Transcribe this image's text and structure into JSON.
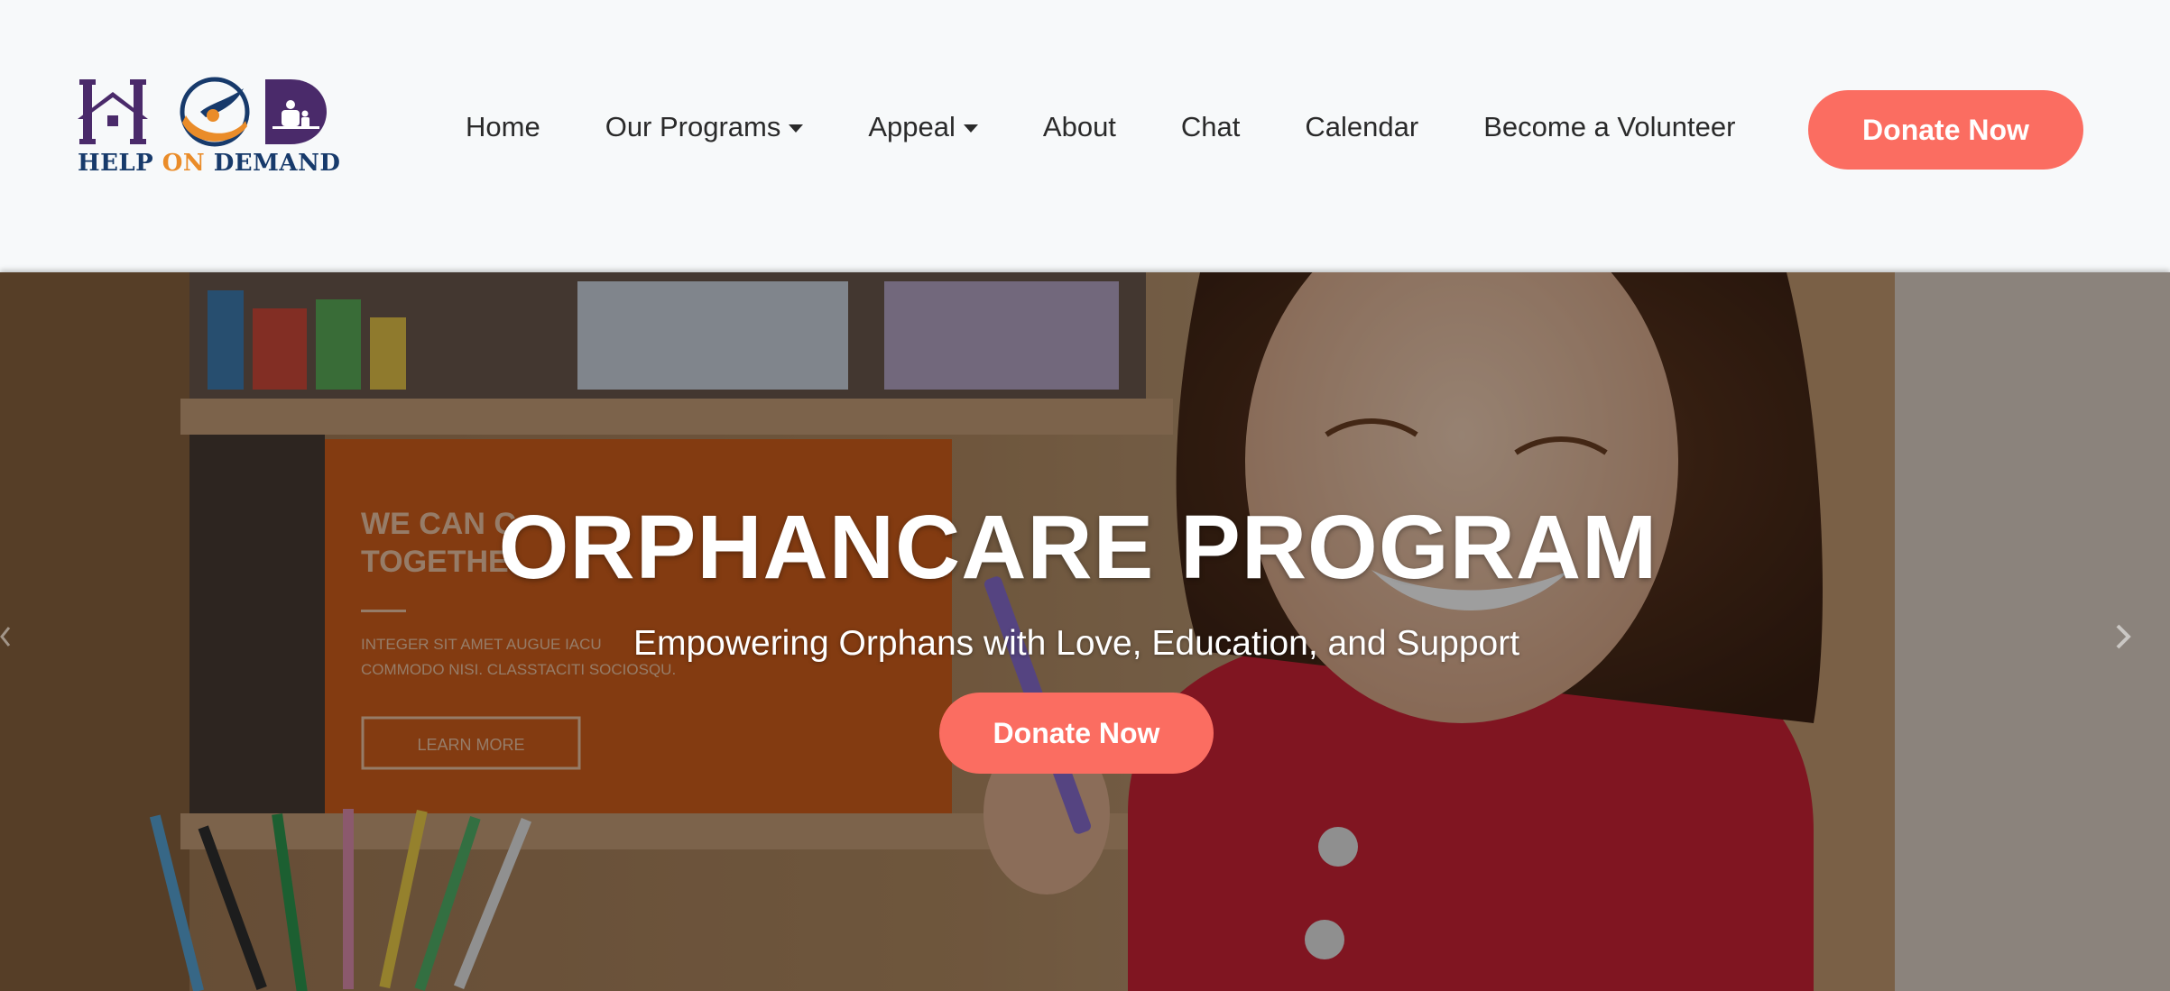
{
  "brand": {
    "logo_letters": "HOD",
    "logo_text_part1": "HELP ",
    "logo_text_part2": "ON",
    "logo_text_part3": " DEMAND",
    "colors": {
      "purple": "#4a2a6a",
      "navy": "#173a6b",
      "orange": "#ea8c29"
    }
  },
  "nav": {
    "items": [
      {
        "label": "Home",
        "dropdown": false
      },
      {
        "label": "Our Programs",
        "dropdown": true
      },
      {
        "label": "Appeal",
        "dropdown": true
      },
      {
        "label": "About",
        "dropdown": false
      },
      {
        "label": "Chat",
        "dropdown": false
      },
      {
        "label": "Calendar",
        "dropdown": false
      },
      {
        "label": "Become a Volunteer",
        "dropdown": false
      }
    ],
    "cta_label": "Donate Now",
    "cta_color": "#fb6d61"
  },
  "hero": {
    "title": "ORPHANCARE PROGRAM",
    "subtitle": "Empowering Orphans with Love, Education, and Support",
    "cta_label": "Donate Now",
    "background_sign": {
      "line1": "WE CAN C",
      "line2": "TOGETHE",
      "body1": "INTEGER SIT AMET AUGUE IACU",
      "body2": "COMMODO NISI. CLASSTACITI SOCIOSQU.",
      "button": "LEARN MORE"
    },
    "icons": {
      "next": "chevron-right-icon",
      "prev": "chevron-left-icon"
    }
  }
}
